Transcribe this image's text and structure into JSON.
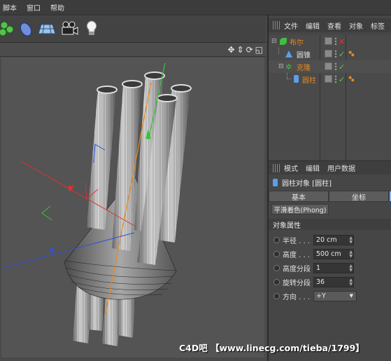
{
  "menubar": {
    "items": [
      "脚本",
      "窗口",
      "帮助"
    ]
  },
  "toolbar": {
    "tools": [
      "primitive-icon",
      "deformer-icon",
      "floor-icon",
      "camera-icon",
      "light-icon"
    ]
  },
  "viewport": {
    "nav_icons": [
      "move-view-icon",
      "zoom-view-icon",
      "rotate-view-icon",
      "maximize-view-icon"
    ]
  },
  "object_manager": {
    "menu": [
      "文件",
      "编辑",
      "查看",
      "对象",
      "标签"
    ],
    "objects": [
      {
        "name": "布尔",
        "color": "#e8891e",
        "status": "✕",
        "status_color": "#e03030",
        "tag": ""
      },
      {
        "name": "圆锥",
        "color": "#e0e0e0",
        "status": "✓",
        "status_color": "#4cd24c",
        "tag": "material-tag-icon"
      },
      {
        "name": "克隆",
        "color": "#e8891e",
        "status": "✓",
        "status_color": "#4cd24c",
        "tag": ""
      },
      {
        "name": "圆柱",
        "color": "#e8891e",
        "status": "✓",
        "status_color": "#4cd24c",
        "tag": "material-tag-icon"
      }
    ]
  },
  "attribute_manager": {
    "menu": [
      "模式",
      "编辑",
      "用户数据"
    ],
    "title": "圆柱对象 [圆柱]",
    "tabs": [
      "基本",
      "坐标"
    ],
    "phong": "平滑着色(Phong)",
    "section": "对象属性",
    "props": [
      {
        "label": "半径 . . .",
        "value": "20 cm"
      },
      {
        "label": "高度 . . .",
        "value": "500 cm"
      },
      {
        "label": "高度分段",
        "value": "1"
      },
      {
        "label": "旋转分段",
        "value": "36"
      }
    ],
    "direction": {
      "label": "方向 . . .",
      "value": "+Y"
    }
  },
  "watermark": "C4D吧 【www.linecg.com/tieba/1799】",
  "colors": {
    "accent": "#e8891e",
    "bg": "#4a4a4a",
    "axis_x": "#e03030",
    "axis_y": "#3ec03e",
    "axis_z": "#3050e0"
  }
}
